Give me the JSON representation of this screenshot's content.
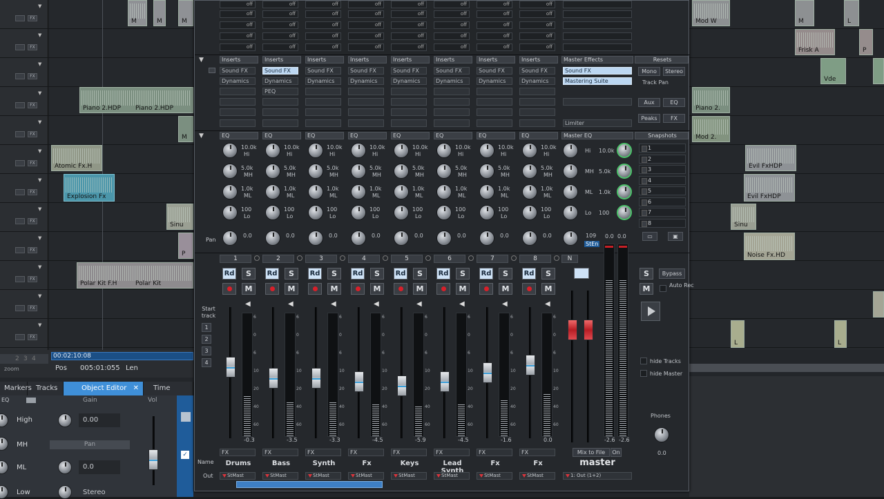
{
  "arranger": {
    "track_btn_fx": "FX",
    "tracks": [
      {
        "num": ""
      },
      {
        "num": ""
      },
      {
        "num": ""
      },
      {
        "num": ""
      },
      {
        "num": ""
      },
      {
        "num": ""
      },
      {
        "num": ""
      },
      {
        "num": ""
      },
      {
        "num": ""
      },
      {
        "num": ""
      },
      {
        "num": ""
      },
      {
        "num": ""
      }
    ],
    "clips_left": [
      "Piano 2.HDP",
      "Piano 2.HDP",
      "Atomic Fx.H",
      "Explosion Fx",
      "Sinu",
      "Polar Kit F.H",
      "Polar Kit"
    ],
    "clips_right": [
      "Mod W",
      "Frisk A",
      "Vde",
      "Piano 2.",
      "Mod 2.",
      "Evil FxHDP",
      "Evil FxHDP",
      "Sinu",
      "Noise Fx.HD"
    ],
    "clips_small": [
      "M",
      "M",
      "M",
      "L",
      "P",
      "P",
      "L",
      "L"
    ],
    "time": "00:02:10:08",
    "pos_label": "Pos",
    "pos_value": "005:01:055",
    "len_label": "Len",
    "zoom_label": "zoom",
    "zoom_steps": [
      "2",
      "3",
      "4"
    ]
  },
  "bottom_tabs": [
    "Markers",
    "Tracks",
    "Object Editor",
    "Time display"
  ],
  "object_editor": {
    "eq_label": "EQ",
    "gain_label": "Gain",
    "gain_value": "0.00",
    "pan_label": "Pan",
    "pan_value": "0.0",
    "stereo_label": "Stereo",
    "vol_label": "Vol",
    "bands": [
      "High",
      "MH",
      "ML",
      "Low"
    ]
  },
  "mixer": {
    "off_label": "off",
    "inserts_label": "Inserts",
    "eq_label": "EQ",
    "pan_label": "Pan",
    "eq_bands": [
      {
        "freq": "10.0k",
        "band": "Hi"
      },
      {
        "freq": "5.0k",
        "band": "MH"
      },
      {
        "freq": "1.0k",
        "band": "ML"
      },
      {
        "freq": "100",
        "band": "Lo"
      }
    ],
    "pan_value": "0.0",
    "solo": "S",
    "mute": "M",
    "rd": "Rd",
    "start_track": "Start track",
    "start_nums": [
      "1",
      "2",
      "3",
      "4"
    ],
    "name_label": "Name",
    "out_label": "Out",
    "fx_label": "FX",
    "scale": [
      "6",
      "0",
      "6",
      "10",
      "20",
      "40",
      "60"
    ],
    "channels": [
      {
        "num": "1",
        "name": "Drums",
        "slot1": "Sound FX",
        "slot1_on": false,
        "slot2": "Dynamics",
        "slot3": "",
        "peak": "-0.3",
        "out": "StMast",
        "fader": 0.55
      },
      {
        "num": "2",
        "name": "Bass",
        "slot1": "Sound FX",
        "slot1_on": true,
        "slot2": "Dynamics",
        "slot3": "PEQ",
        "peak": "-3.5",
        "out": "StMast",
        "fader": 0.45
      },
      {
        "num": "3",
        "name": "Synth",
        "slot1": "Sound FX",
        "slot1_on": false,
        "slot2": "Dynamics",
        "slot3": "",
        "peak": "-3.3",
        "out": "StMast",
        "fader": 0.45
      },
      {
        "num": "4",
        "name": "Fx",
        "slot1": "Sound FX",
        "slot1_on": false,
        "slot2": "Dynamics",
        "slot3": "",
        "peak": "-4.5",
        "out": "StMast",
        "fader": 0.42
      },
      {
        "num": "5",
        "name": "Keys",
        "slot1": "Sound FX",
        "slot1_on": false,
        "slot2": "Dynamics",
        "slot3": "",
        "peak": "-5.9",
        "out": "StMast",
        "fader": 0.38
      },
      {
        "num": "6",
        "name": "Lead Synth",
        "slot1": "Sound FX",
        "slot1_on": false,
        "slot2": "Dynamics",
        "slot3": "",
        "peak": "-4.5",
        "out": "StMast",
        "fader": 0.42
      },
      {
        "num": "7",
        "name": "Fx",
        "slot1": "Sound FX",
        "slot1_on": false,
        "slot2": "Dynamics",
        "slot3": "",
        "peak": "-1.6",
        "out": "StMast",
        "fader": 0.5
      },
      {
        "num": "8",
        "name": "Fx",
        "slot1": "Sound FX",
        "slot1_on": false,
        "slot2": "Dynamics",
        "slot3": "",
        "peak": "0.0",
        "out": "StMast",
        "fader": 0.57
      }
    ],
    "master": {
      "effects_label": "Master Effects",
      "slot1": "Sound FX",
      "slot2": "Mastering Suite",
      "slot_limiter": "Limiter",
      "eq_label": "Master EQ",
      "bands": [
        {
          "band": "Hi",
          "freq": "10.0k"
        },
        {
          "band": "MH",
          "freq": "5.0k"
        },
        {
          "band": "ML",
          "freq": "1.0k"
        },
        {
          "band": "Lo",
          "freq": "100"
        }
      ],
      "vol_value": "109",
      "vol_unit": "StEn",
      "peak_l": "0.0",
      "peak_r": "0.0",
      "bot_l": "-2.6",
      "bot_r": "-2.6",
      "mix_to_file": "Mix to File",
      "on": "On",
      "name": "master",
      "out": "1: Out (1+2)",
      "n_label": "N"
    },
    "resets": {
      "label": "Resets",
      "mono": "Mono",
      "stereo": "Stereo",
      "track_pan": "Track Pan",
      "aux": "Aux",
      "eq": "EQ",
      "peaks": "Peaks",
      "fx": "FX"
    },
    "snapshots": {
      "label": "Snapshots",
      "items": [
        "1",
        "2",
        "3",
        "4",
        "5",
        "6",
        "7",
        "8"
      ]
    },
    "side": {
      "solo": "S",
      "bypass": "Bypass",
      "mute": "M",
      "auto_rec": "Auto Rec",
      "hide_tracks": "hide Tracks",
      "hide_master": "hide Master",
      "phones": "Phones",
      "phones_value": "0.0"
    }
  }
}
